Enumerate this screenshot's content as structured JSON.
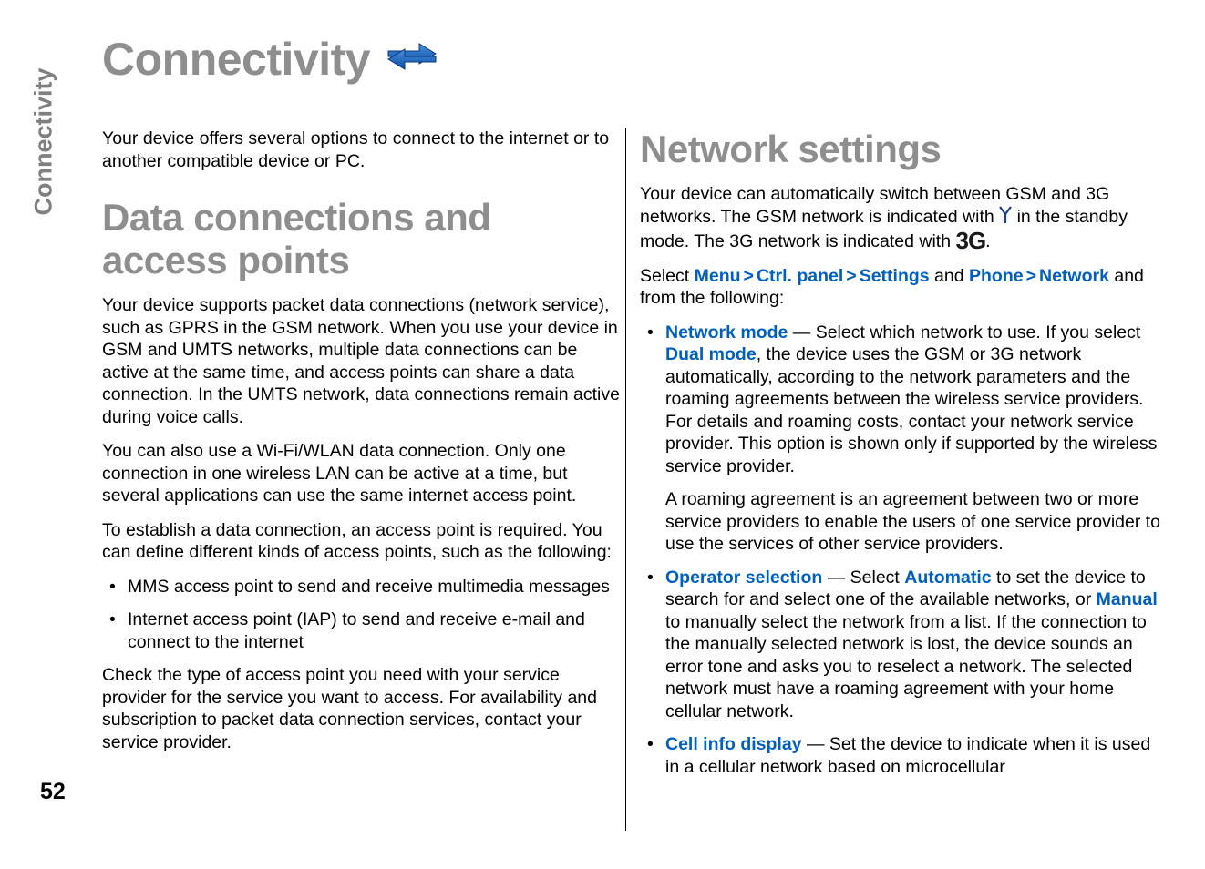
{
  "page": {
    "running_head": "Connectivity",
    "page_number": "52",
    "title": "Connectivity",
    "title_icon": "blue-double-arrow-icon"
  },
  "left_column": {
    "intro": "Your device offers several options to connect to the internet or to another compatible device or PC.",
    "heading": "Data connections and access points",
    "paragraphs": [
      "Your device supports packet data connections (network service), such as GPRS in the GSM network. When you use your device in GSM and UMTS networks, multiple data connections can be active at the same time, and access points can share a data connection. In the UMTS network, data connections remain active during voice calls.",
      "You can also use a Wi-Fi/WLAN data connection. Only one connection in one wireless LAN can be active at a time, but several applications can use the same internet access point.",
      "To establish a data connection, an access point is required. You can define different kinds of access points, such as the following:"
    ],
    "bullets": [
      "MMS access point to send and receive multimedia messages",
      "Internet access point (IAP) to send and receive e-mail and connect to the internet"
    ],
    "closing": "Check the type of access point you need with your service provider for the service you want to access. For availability and subscription to packet data connection services, contact your service provider."
  },
  "right_column": {
    "heading": "Network settings",
    "intro_part1": "Your device can automatically switch between GSM and 3G networks. The GSM network is indicated with",
    "intro_part2": "in the standby mode. The 3G network is indicated with",
    "intro_icon_gsm": "antenna-icon",
    "intro_icon_3g": "3G",
    "intro_part3": ".",
    "select_prefix": "Select",
    "path": [
      {
        "label": "Menu",
        "sep": ">"
      },
      {
        "label": "Ctrl. panel",
        "sep": ">"
      },
      {
        "label": "Settings",
        "sep": ""
      }
    ],
    "select_and": "and",
    "path_phone": "Phone",
    "path_sep2": ">",
    "path_network": "Network",
    "select_suffix": "and from the following:",
    "bullets": [
      {
        "term": "Network mode",
        "dash": "—",
        "text_a": "Select which network to use. If you select",
        "emph": "Dual mode",
        "text_b": ", the device uses the GSM or 3G network automatically, according to the network parameters and the roaming agreements between the wireless service providers. For details and roaming costs, contact your network service provider. This option is shown only if supported by the wireless service provider.",
        "sub_para": "A roaming agreement is an agreement between two or more service providers to enable the users of one service provider to use the services of other service providers."
      },
      {
        "term": "Operator selection",
        "dash": "—",
        "text_a": "Select",
        "emph": "Automatic",
        "text_b": "to set the device to search for and select one of the available networks, or",
        "emph2": "Manual",
        "text_c": "to manually select the network from a list. If the connection to the manually selected network is lost, the device sounds an error tone and asks you to reselect a network. The selected network must have a roaming agreement with your home cellular network."
      },
      {
        "term": "Cell info display",
        "dash": "—",
        "text_a": "Set the device to indicate when it is used in a cellular network based on microcellular"
      }
    ]
  },
  "colors": {
    "heading_gray": "#8e8e8e",
    "link_blue": "#0060c0",
    "text_black": "#000000"
  }
}
